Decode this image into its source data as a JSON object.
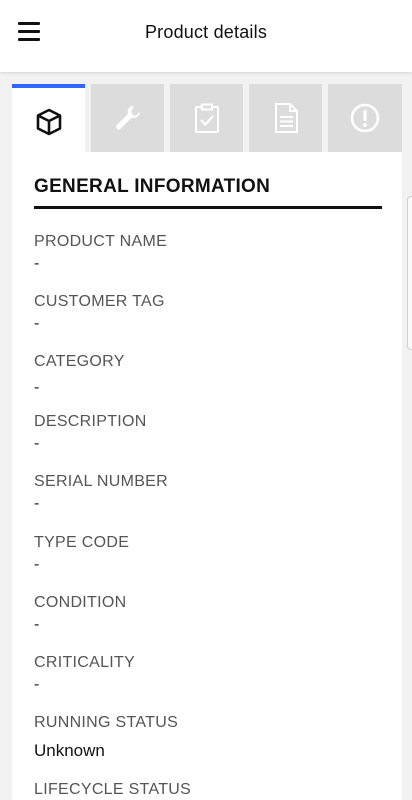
{
  "appbar": {
    "title": "Product details",
    "menu_icon": "hamburger-menu-icon"
  },
  "tabs": [
    {
      "icon": "cube-icon",
      "active": true
    },
    {
      "icon": "wrench-icon",
      "active": false
    },
    {
      "icon": "clipboard-check-icon",
      "active": false
    },
    {
      "icon": "document-icon",
      "active": false
    },
    {
      "icon": "alert-circle-icon",
      "active": false
    }
  ],
  "colors": {
    "active_tab_accent": "#3366ff",
    "inactive_tab_bg": "#dcdcdc",
    "background": "#f2f2f2"
  },
  "section": {
    "title": "GENERAL INFORMATION"
  },
  "fields": [
    {
      "label": "PRODUCT NAME",
      "value": "-"
    },
    {
      "label": "CUSTOMER TAG",
      "value": "-"
    },
    {
      "label": "CATEGORY",
      "value": "-"
    },
    {
      "label": "DESCRIPTION",
      "value": "-"
    },
    {
      "label": "SERIAL NUMBER",
      "value": "-"
    },
    {
      "label": "TYPE CODE",
      "value": "-"
    },
    {
      "label": "CONDITION",
      "value": "-"
    },
    {
      "label": "CRITICALITY",
      "value": "-"
    },
    {
      "label": "RUNNING STATUS",
      "value": "Unknown"
    },
    {
      "label": "LIFECYCLE STATUS",
      "value": ""
    }
  ]
}
